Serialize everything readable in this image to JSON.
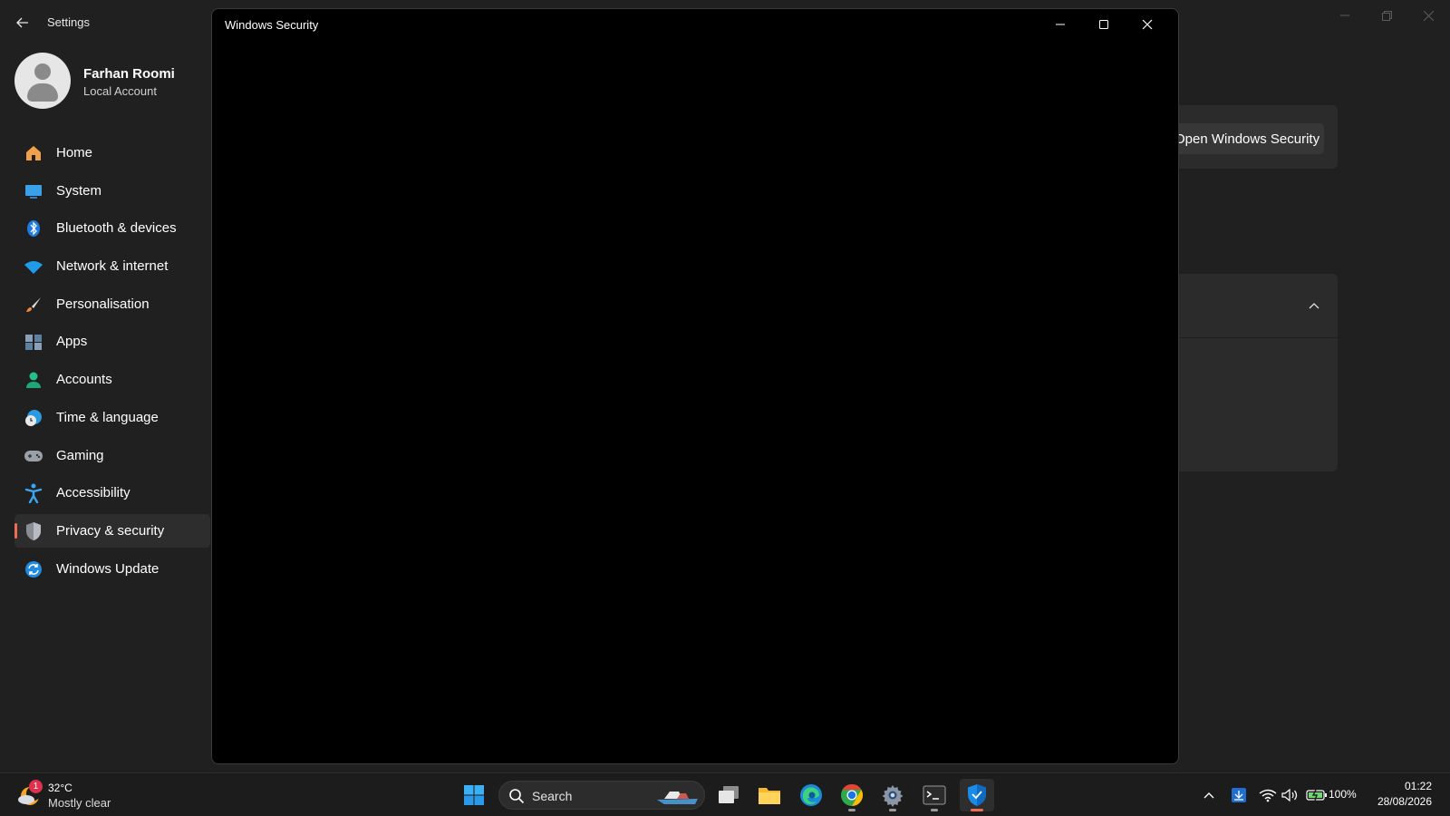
{
  "settings": {
    "title": "Settings",
    "user": {
      "name": "Farhan Roomi",
      "account_type": "Local Account"
    },
    "nav": [
      {
        "label": "Home",
        "icon": "home-icon"
      },
      {
        "label": "System",
        "icon": "system-icon"
      },
      {
        "label": "Bluetooth & devices",
        "icon": "bluetooth-icon"
      },
      {
        "label": "Network & internet",
        "icon": "wifi-icon"
      },
      {
        "label": "Personalisation",
        "icon": "brush-icon"
      },
      {
        "label": "Apps",
        "icon": "apps-icon"
      },
      {
        "label": "Accounts",
        "icon": "accounts-icon"
      },
      {
        "label": "Time & language",
        "icon": "clock-globe-icon"
      },
      {
        "label": "Gaming",
        "icon": "gamepad-icon"
      },
      {
        "label": "Accessibility",
        "icon": "accessibility-icon"
      },
      {
        "label": "Privacy & security",
        "icon": "shield-icon",
        "active": true
      },
      {
        "label": "Windows Update",
        "icon": "update-icon"
      }
    ],
    "open_security_button": "Open Windows Security"
  },
  "security_window": {
    "title": "Windows Security"
  },
  "taskbar": {
    "weather": {
      "temp": "32°C",
      "condition": "Mostly clear",
      "badge": "1"
    },
    "search_label": "Search",
    "battery": "100%",
    "time": "01:22",
    "date": "28/08/2026"
  },
  "colors": {
    "accent": "#f06c55",
    "background": "#202020",
    "taskbar": "#1c1c1c",
    "windows_blue": "#0078d4"
  }
}
